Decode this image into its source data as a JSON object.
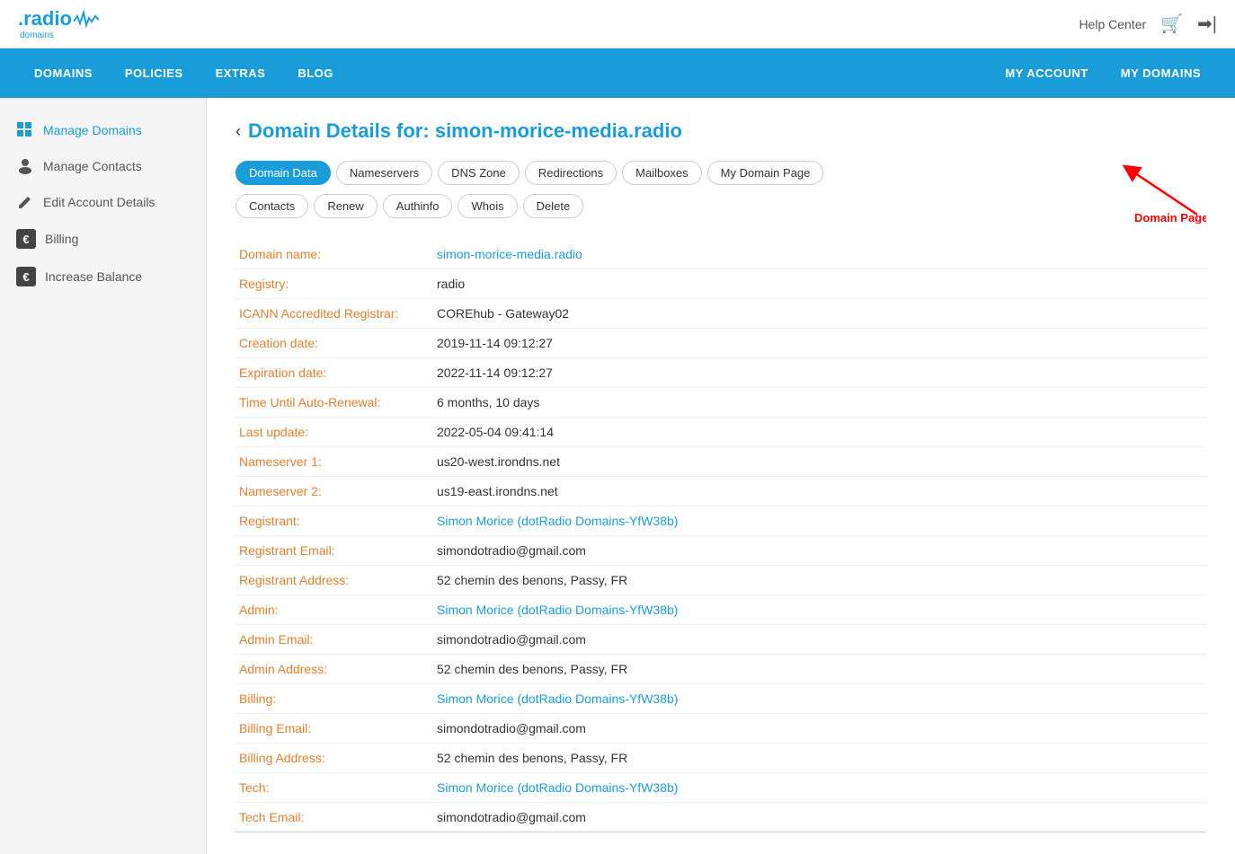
{
  "logo": {
    "text": ".radio",
    "sub": "domains",
    "wave": "~"
  },
  "topRight": {
    "helpCenter": "Help Center",
    "cartIcon": "🛒",
    "loginIcon": "➡|"
  },
  "nav": {
    "left": [
      "DOMAINS",
      "POLICIES",
      "EXTRAS",
      "BLOG"
    ],
    "right": [
      "MY ACCOUNT",
      "MY DOMAINS"
    ]
  },
  "sidebar": {
    "items": [
      {
        "label": "Manage Domains",
        "icon": "grid",
        "active": true
      },
      {
        "label": "Manage Contacts",
        "icon": "person",
        "active": false
      },
      {
        "label": "Edit Account Details",
        "icon": "pencil",
        "active": false
      },
      {
        "label": "Billing",
        "icon": "billing",
        "active": false
      },
      {
        "label": "Increase Balance",
        "icon": "balance",
        "active": false
      }
    ]
  },
  "pageTitle": {
    "prefix": "Domain Details for:",
    "domain": "simon-morice-media.radio"
  },
  "tabs": [
    {
      "label": "Domain Data",
      "active": true
    },
    {
      "label": "Nameservers",
      "active": false
    },
    {
      "label": "DNS Zone",
      "active": false
    },
    {
      "label": "Redirections",
      "active": false
    },
    {
      "label": "Mailboxes",
      "active": false
    },
    {
      "label": "My Domain Page",
      "active": false
    }
  ],
  "tabs2": [
    {
      "label": "Contacts",
      "active": false
    },
    {
      "label": "Renew",
      "active": false
    },
    {
      "label": "Authinfo",
      "active": false
    },
    {
      "label": "Whois",
      "active": false
    },
    {
      "label": "Delete",
      "active": false
    }
  ],
  "arrowLabel": "Domain Page",
  "domainData": [
    {
      "label": "Domain name:",
      "value": "simon-morice-media.radio",
      "type": "link"
    },
    {
      "label": "Registry:",
      "value": "radio",
      "type": "plain"
    },
    {
      "label": "ICANN Accredited Registrar:",
      "value": "COREhub - Gateway02",
      "type": "plain"
    },
    {
      "label": "Creation date:",
      "value": "2019-11-14 09:12:27",
      "type": "plain"
    },
    {
      "label": "Expiration date:",
      "value": "2022-11-14 09:12:27",
      "type": "plain"
    },
    {
      "label": "Time Until Auto-Renewal:",
      "value": "6 months, 10 days",
      "type": "plain"
    },
    {
      "label": "Last update:",
      "value": "2022-05-04 09:41:14",
      "type": "plain"
    },
    {
      "label": "Nameserver 1:",
      "value": "us20-west.irondns.net",
      "type": "plain"
    },
    {
      "label": "Nameserver 2:",
      "value": "us19-east.irondns.net",
      "type": "plain"
    },
    {
      "label": "Registrant:",
      "value": "Simon Morice (dotRadio Domains-YfW38b)",
      "type": "link"
    },
    {
      "label": "Registrant Email:",
      "value": "simondotradio@gmail.com",
      "type": "plain"
    },
    {
      "label": "Registrant Address:",
      "value": "52 chemin des benons, Passy, FR",
      "type": "plain"
    },
    {
      "label": "Admin:",
      "value": "Simon Morice (dotRadio Domains-YfW38b)",
      "type": "link"
    },
    {
      "label": "Admin Email:",
      "value": "simondotradio@gmail.com",
      "type": "plain"
    },
    {
      "label": "Admin Address:",
      "value": "52 chemin des benons, Passy, FR",
      "type": "plain"
    },
    {
      "label": "Billing:",
      "value": "Simon Morice (dotRadio Domains-YfW38b)",
      "type": "link"
    },
    {
      "label": "Billing Email:",
      "value": "simondotradio@gmail.com",
      "type": "plain"
    },
    {
      "label": "Billing Address:",
      "value": "52 chemin des benons, Passy, FR",
      "type": "plain"
    },
    {
      "label": "Tech:",
      "value": "Simon Morice (dotRadio Domains-YfW38b)",
      "type": "link"
    },
    {
      "label": "Tech Email:",
      "value": "simondotradio@gmail.com",
      "type": "plain"
    }
  ]
}
